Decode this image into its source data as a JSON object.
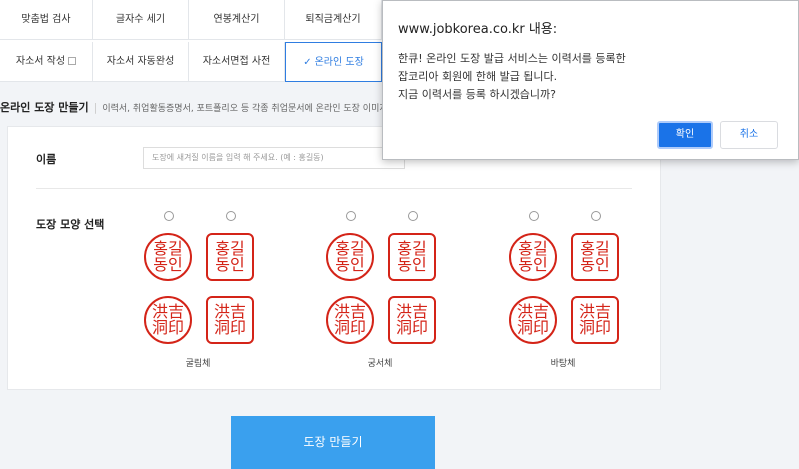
{
  "tabs_row1": [
    "맞춤법 검사",
    "글자수 세기",
    "연봉계산기",
    "퇴직금계산기"
  ],
  "tabs_row2": [
    {
      "label": "자소서 작성",
      "icon": "external-icon"
    },
    {
      "label": "자소서 자동완성"
    },
    {
      "label": "자소서면접 사전"
    },
    {
      "label": "온라인 도장",
      "active": true,
      "icon": "check-icon"
    }
  ],
  "section": {
    "title": "온라인 도장 만들기",
    "desc": "이력서, 취업활동증명서, 포트폴리오 등 각종 취업문서에 온라인 도장 이미지"
  },
  "form": {
    "name_label": "이름",
    "name_placeholder": "도장에 새겨질 이름을 입력 해 주세요. (예 : 홍길동)",
    "shape_label": "도장 모양 선택"
  },
  "seal_styles": [
    {
      "name": "굴림체",
      "seals": [
        [
          "홍길",
          "동인"
        ],
        [
          "홍길",
          "동인"
        ],
        [
          "洪吉",
          "洞印"
        ],
        [
          "洪吉",
          "洞印"
        ]
      ]
    },
    {
      "name": "궁서체",
      "seals": [
        [
          "홍길",
          "동인"
        ],
        [
          "홍길",
          "동인"
        ],
        [
          "洪吉",
          "洞印"
        ],
        [
          "洪吉",
          "洞印"
        ]
      ]
    },
    {
      "name": "바탕체",
      "seals": [
        [
          "홍길",
          "동인"
        ],
        [
          "홍길",
          "동인"
        ],
        [
          "洪吉",
          "洞印"
        ],
        [
          "洪吉",
          "洞印"
        ]
      ]
    }
  ],
  "colors": {
    "accent": "#2f7de1",
    "seal_red": "#d42418",
    "button_blue": "#3aa0ee",
    "dialog_primary": "#1a73e8"
  },
  "make_button": "도장 만들기",
  "dialog": {
    "title": "www.jobkorea.co.kr 내용:",
    "message": [
      "한큐! 온라인 도장 발급 서비스는 이력서를 등록한",
      "잡코리아 회원에 한해 발급 됩니다.",
      "지금 이력서를 등록 하시겠습니까?"
    ],
    "ok": "확인",
    "cancel": "취소"
  }
}
